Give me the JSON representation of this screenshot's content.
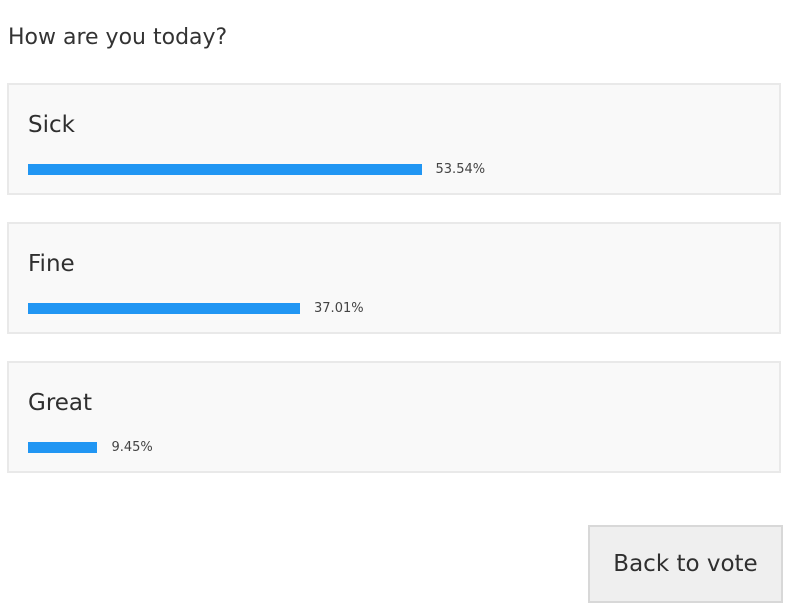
{
  "poll": {
    "question": "How are you today?",
    "options": [
      {
        "label": "Sick",
        "percent_text": "53.54%",
        "percent": 53.54
      },
      {
        "label": "Fine",
        "percent_text": "37.01%",
        "percent": 37.01
      },
      {
        "label": "Great",
        "percent_text": "9.45%",
        "percent": 9.45
      }
    ],
    "bar_color": "#2196f3"
  },
  "actions": {
    "back_label": "Back to vote"
  }
}
